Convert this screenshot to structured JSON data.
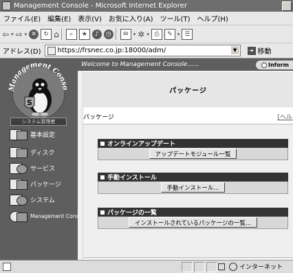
{
  "window": {
    "title": "Management Console - Microsoft Internet Explorer"
  },
  "menubar": {
    "items": [
      "ファイル(E)",
      "編集(E)",
      "表示(V)",
      "お気に入り(A)",
      "ツール(T)",
      "ヘルプ(H)"
    ]
  },
  "address": {
    "label": "アドレス(D)",
    "url": "https://frsnec.co.jp:18000/adm/",
    "go_label": "移動"
  },
  "leftnav": {
    "logo_text": "Management Console",
    "logo_letter": "S",
    "section_header": "システム管理者",
    "items": [
      {
        "label": "基本設定"
      },
      {
        "label": "ディスク"
      },
      {
        "label": "サービス"
      },
      {
        "label": "パッケージ"
      },
      {
        "label": "システム"
      },
      {
        "label": "Management Console"
      }
    ]
  },
  "main": {
    "welcome": "Welcome to Management Console......",
    "info_tab": "Inform",
    "page_title": "パッケージ",
    "breadcrumb": "パッケージ",
    "help_link": "[ヘルプ",
    "sections": [
      {
        "title": "オンラインアップデート",
        "button": "アップデートモジュール一覧"
      },
      {
        "title": "手動インストール",
        "button": "手動インストール..."
      },
      {
        "title": "パッケージの一覧",
        "button": "インストールされているパッケージの一覧..."
      }
    ]
  },
  "statusbar": {
    "zone": "インターネット"
  }
}
